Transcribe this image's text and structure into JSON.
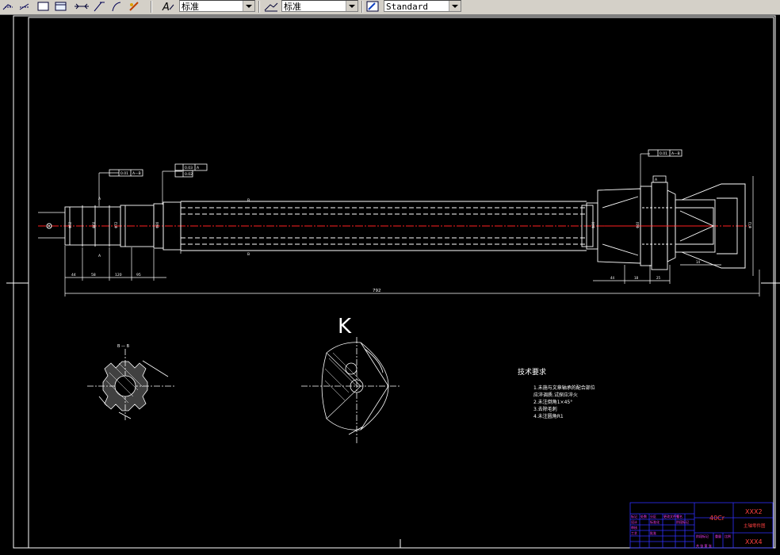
{
  "toolbar": {
    "text_style_value": "标准",
    "dim_style_value": "标准",
    "table_style_value": "Standard"
  },
  "drawing": {
    "overall_length_label": "792",
    "section_label": "K",
    "section_marker": "B — B",
    "tech_title": "技术要求",
    "tech_items": [
      "1.未施与文章轴承的配合部位",
      "  应淬调质.试探应淬火",
      "2.未注倒角1×45°",
      "3.去除毛刺",
      "4.未注圆角R1"
    ],
    "dim_labels": [
      "Φ52",
      "Φ60",
      "Φ72",
      "Φ80",
      "Φ40",
      "Φ90",
      "58",
      "44",
      "120",
      "95"
    ],
    "gd_boxes": [
      "0.01  A — B",
      "0.01  A",
      "0.03  A — B",
      "0.02"
    ],
    "title_block": {
      "material": "40Cr",
      "drawing_no": "XXX2",
      "part_name": "主轴零件图",
      "company": "XXX4"
    }
  },
  "colors": {
    "background": "#000000",
    "line": "#ffffff",
    "centerline": "#ff0000",
    "title_block_border": "#2a2aff",
    "title_text": "#ff4040",
    "magenta": "#ff40ff"
  }
}
